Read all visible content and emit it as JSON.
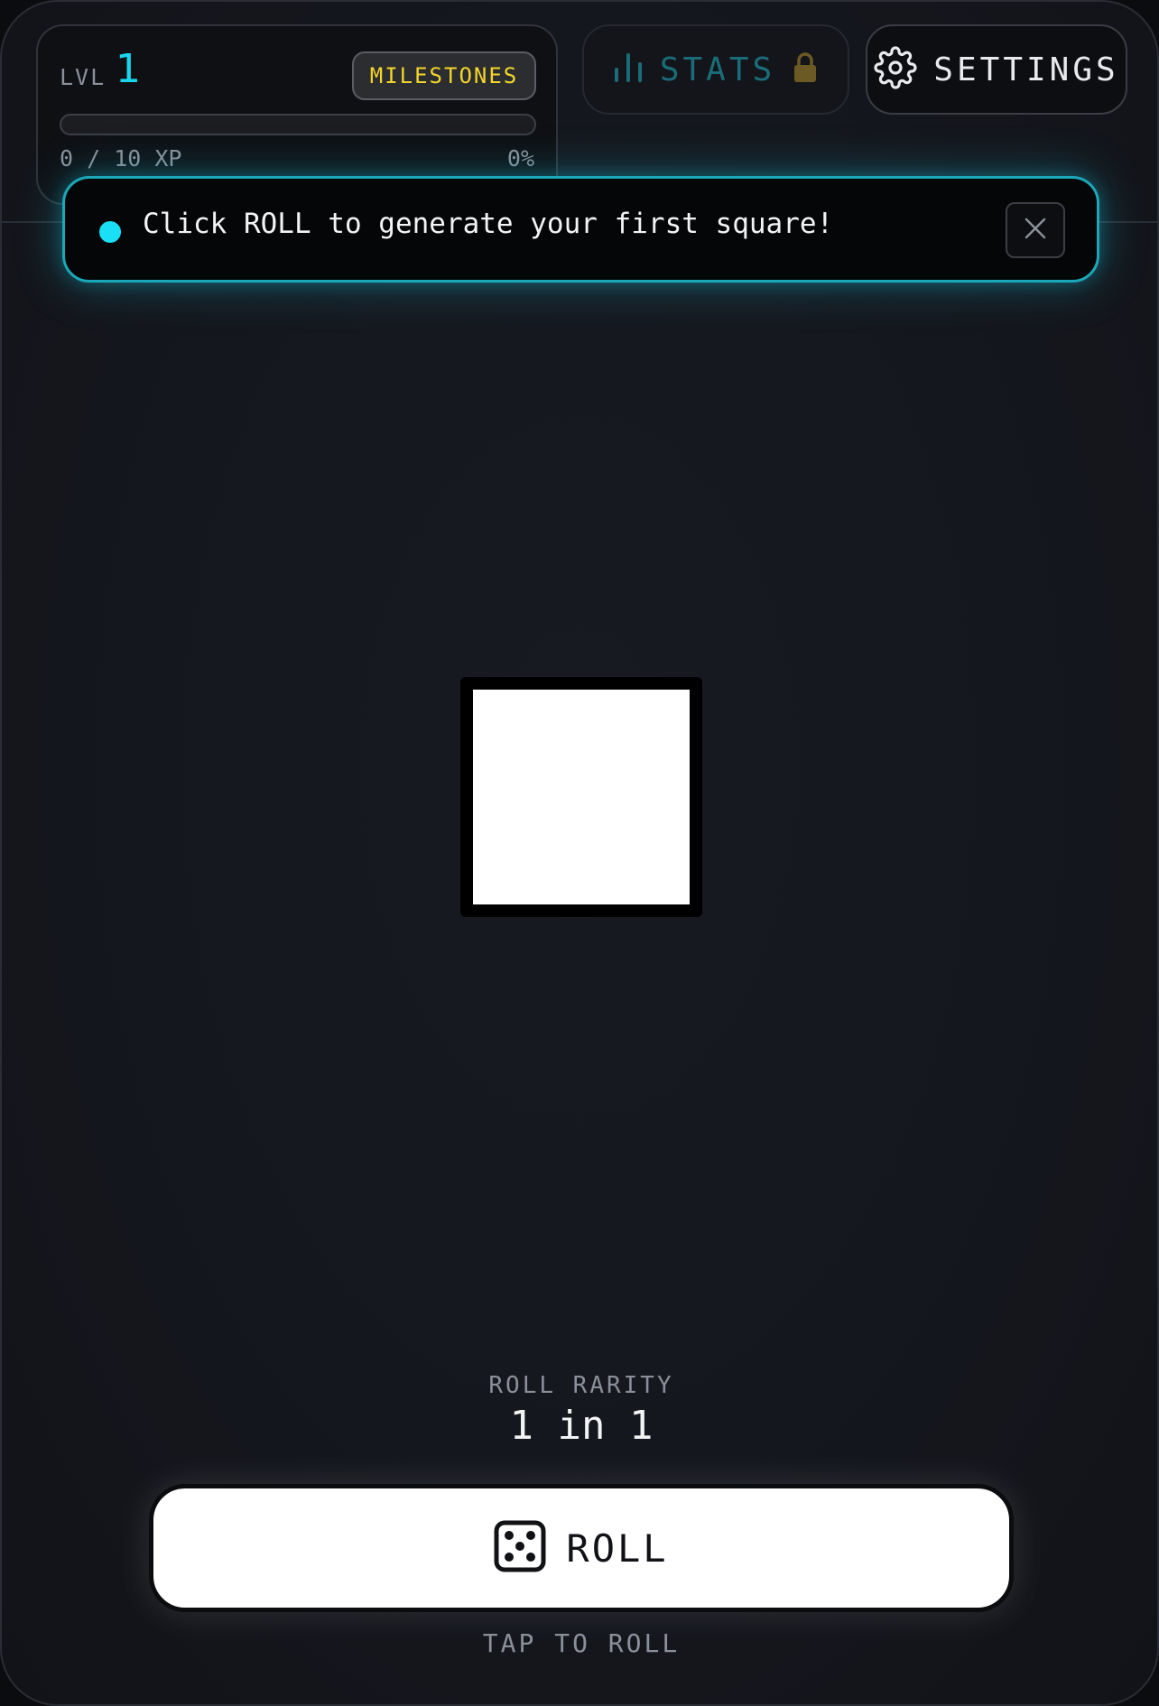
{
  "level_card": {
    "lvl_label": "LVL",
    "level": "1",
    "milestones_label": "MILESTONES",
    "xp_text": "0 / 10 XP",
    "xp_percent_text": "0%",
    "xp_progress": 0
  },
  "nav": {
    "stats_label": "STATS",
    "settings_label": "SETTINGS"
  },
  "toast": {
    "message": "Click ROLL to generate your first square!"
  },
  "square": {
    "color": "#ffffff"
  },
  "rarity": {
    "label": "ROLL RARITY",
    "value": "1 in 1"
  },
  "roll": {
    "label": "ROLL",
    "hint": "TAP TO ROLL"
  },
  "colors": {
    "accent": "#19d6ef",
    "milestone": "#f3d52a",
    "background": "#15171e"
  },
  "icons": {
    "stats": "bar-chart-icon",
    "lock": "lock-icon",
    "settings": "gear-icon",
    "close": "close-icon",
    "dice": "dice-icon"
  }
}
